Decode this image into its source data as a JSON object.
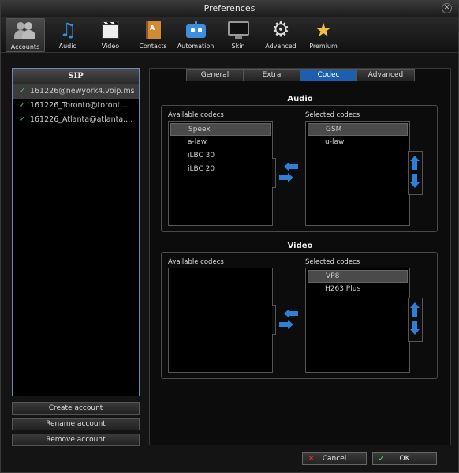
{
  "window": {
    "title": "Preferences"
  },
  "toolbar": {
    "items": [
      {
        "label": "Accounts",
        "icon": "accounts-icon",
        "active": true
      },
      {
        "label": "Audio",
        "icon": "music-note-icon"
      },
      {
        "label": "Video",
        "icon": "clapperboard-icon"
      },
      {
        "label": "Contacts",
        "icon": "address-book-icon"
      },
      {
        "label": "Automation",
        "icon": "robot-icon"
      },
      {
        "label": "Skin",
        "icon": "monitor-icon"
      },
      {
        "label": "Advanced",
        "icon": "gear-icon"
      },
      {
        "label": "Premium",
        "icon": "star-icon"
      }
    ]
  },
  "accounts": {
    "header": "SIP",
    "items": [
      {
        "name": "161226@newyork4.voip.ms",
        "selected": true
      },
      {
        "name": "161226_Toronto@toront..."
      },
      {
        "name": "161226_Atlanta@atlanta...."
      }
    ],
    "buttons": {
      "create": "Create account",
      "rename": "Rename account",
      "remove": "Remove account"
    }
  },
  "tabs": [
    {
      "label": "General"
    },
    {
      "label": "Extra"
    },
    {
      "label": "Codec",
      "active": true
    },
    {
      "label": "Advanced"
    }
  ],
  "audio": {
    "title": "Audio",
    "available_label": "Available codecs",
    "selected_label": "Selected codecs",
    "available": [
      "Speex",
      "a-law",
      "iLBC 30",
      "iLBC 20"
    ],
    "selected": [
      "GSM",
      "u-law"
    ]
  },
  "video": {
    "title": "Video",
    "available_label": "Available codecs",
    "selected_label": "Selected codecs",
    "available": [],
    "selected": [
      "VP8",
      "H263 Plus"
    ]
  },
  "footer": {
    "cancel": "Cancel",
    "ok": "OK"
  },
  "colors": {
    "accent": "#1c5fb0",
    "arrow": "#2f7fd6",
    "check": "#5ad05a",
    "cancel_x": "#e03030"
  }
}
